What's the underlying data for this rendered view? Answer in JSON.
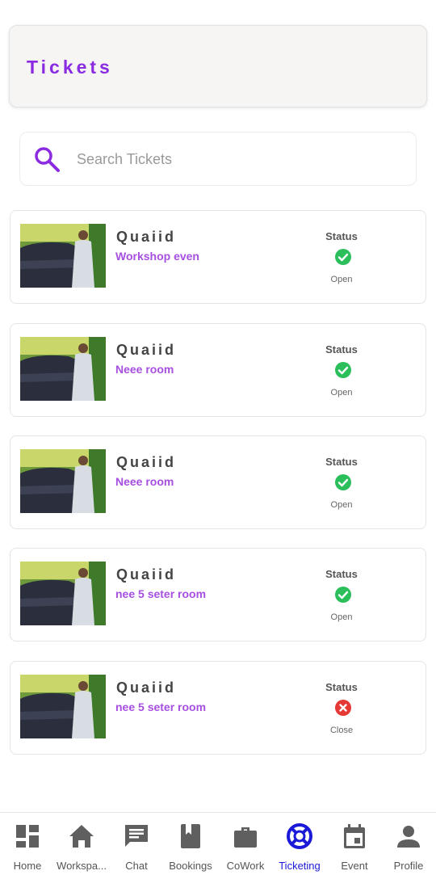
{
  "header": {
    "title": "Tickets"
  },
  "search": {
    "placeholder": "Search Tickets"
  },
  "tickets": [
    {
      "name": "Quaiid",
      "subject": "Workshop even",
      "status_label": "Status",
      "status": "Open"
    },
    {
      "name": "Quaiid",
      "subject": "Neee room",
      "status_label": "Status",
      "status": "Open"
    },
    {
      "name": "Quaiid",
      "subject": "Neee room",
      "status_label": "Status",
      "status": "Open"
    },
    {
      "name": "Quaiid",
      "subject": "nee 5 seter room",
      "status_label": "Status",
      "status": "Open"
    },
    {
      "name": "Quaiid",
      "subject": "nee 5 seter room",
      "status_label": "Status",
      "status": "Close"
    }
  ],
  "nav": {
    "items": [
      {
        "label": "Home",
        "icon": "dashboard-icon"
      },
      {
        "label": "Workspa...",
        "icon": "home-icon"
      },
      {
        "label": "Chat",
        "icon": "chat-icon"
      },
      {
        "label": "Bookings",
        "icon": "book-icon"
      },
      {
        "label": "CoWork",
        "icon": "briefcase-icon"
      },
      {
        "label": "Ticketing",
        "icon": "lifebuoy-icon"
      },
      {
        "label": "Event",
        "icon": "calendar-icon"
      },
      {
        "label": "Profile",
        "icon": "person-icon"
      }
    ],
    "active": "Ticketing"
  },
  "colors": {
    "accent": "#8a2be2",
    "subject": "#a64fe0",
    "active_nav": "#1a1ad8",
    "status_open": "#2bbf5c",
    "status_close": "#e53935",
    "nav_icon": "#5f5f5f"
  }
}
